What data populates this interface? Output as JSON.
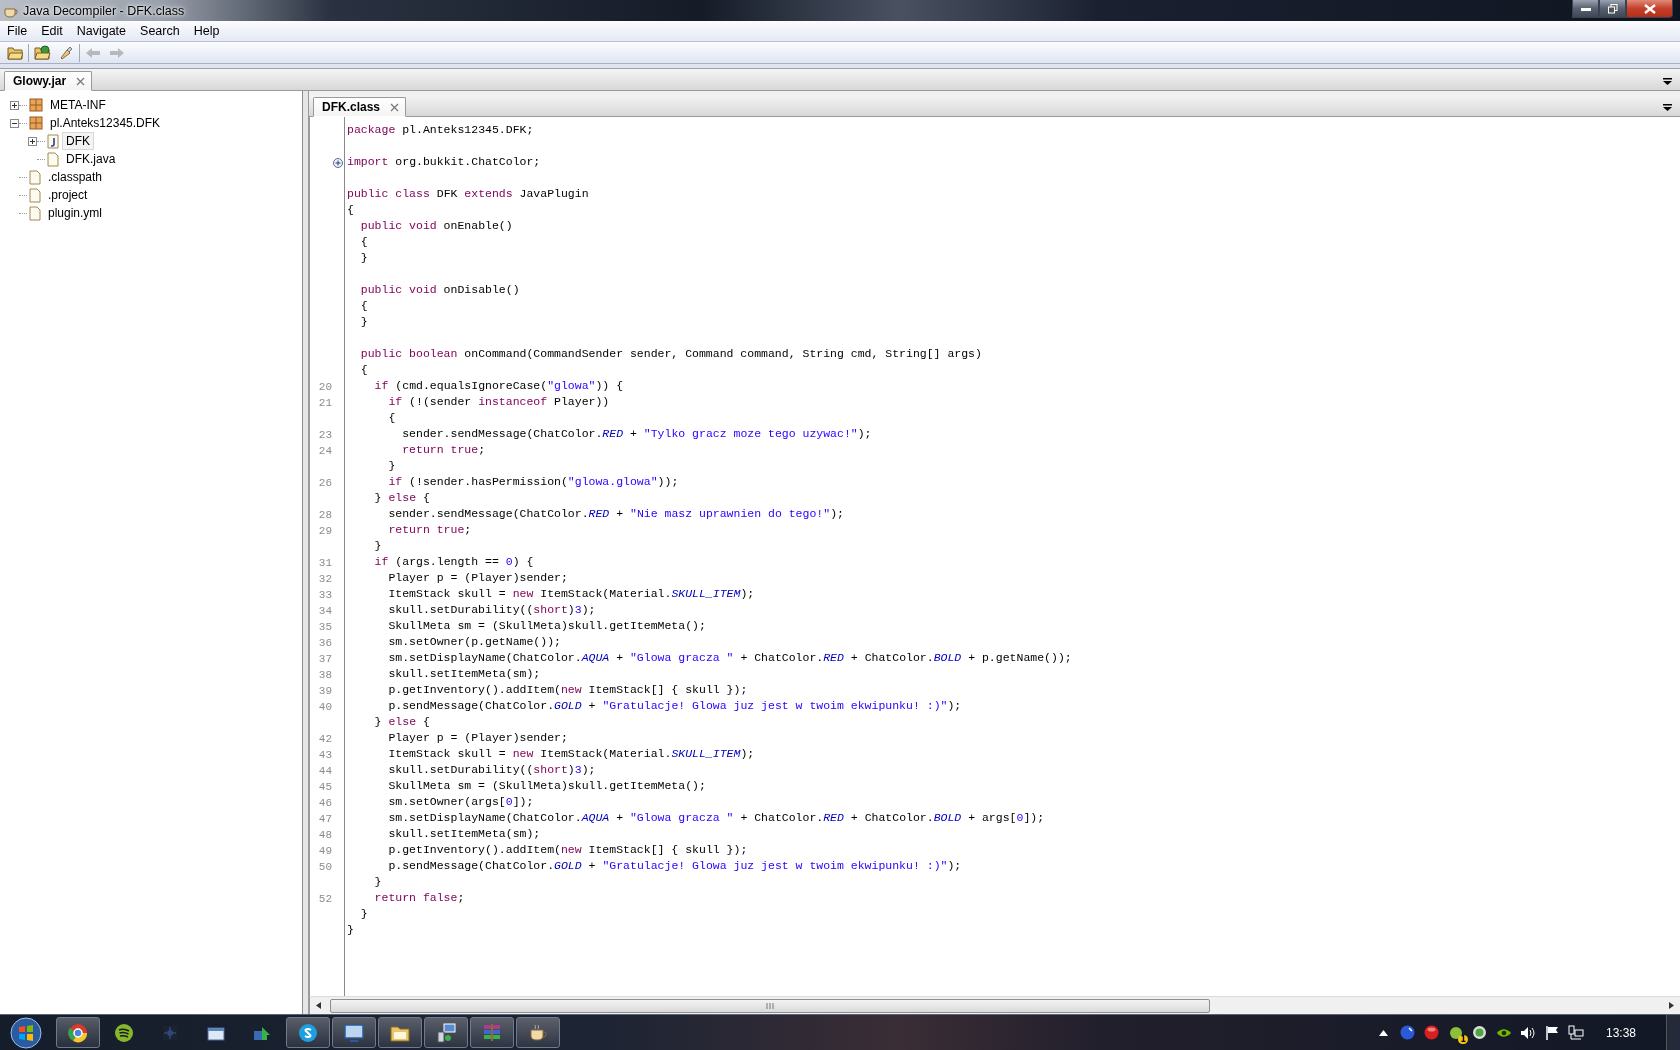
{
  "window": {
    "title": "Java Decompiler - DFK.class"
  },
  "menu": [
    "File",
    "Edit",
    "Navigate",
    "Search",
    "Help"
  ],
  "toolbar": [
    [
      {
        "kind": "open",
        "disabled": false
      }
    ],
    [
      {
        "kind": "open-type",
        "disabled": false
      },
      {
        "kind": "search",
        "disabled": false
      }
    ],
    [
      {
        "kind": "back",
        "disabled": true
      },
      {
        "kind": "forward",
        "disabled": true
      }
    ]
  ],
  "archive_tabs": [
    {
      "label": "Glowy.jar",
      "selected": true
    }
  ],
  "tree": [
    {
      "label": "META-INF",
      "kind": "package",
      "expanded": false,
      "selected": false
    },
    {
      "label": "pl.Anteks12345.DFK",
      "kind": "package",
      "expanded": true,
      "selected": false,
      "children": [
        {
          "label": "DFK",
          "kind": "class",
          "expanded": false,
          "selected": true
        },
        {
          "label": "DFK.java",
          "kind": "file",
          "selected": false
        }
      ]
    },
    {
      "label": ".classpath",
      "kind": "file",
      "selected": false
    },
    {
      "label": ".project",
      "kind": "file",
      "selected": false
    },
    {
      "label": "plugin.yml",
      "kind": "file",
      "selected": false
    }
  ],
  "editor": {
    "tabs": [
      {
        "label": "DFK.class",
        "selected": true
      }
    ],
    "lines": [
      {
        "kind": "code",
        "segments": [
          {
            "kind": "keyword",
            "text": "package"
          },
          {
            "kind": "plain",
            "text": " pl.Anteks12345.DFK;"
          }
        ]
      },
      {
        "kind": "blank"
      },
      {
        "kind": "folded",
        "segments": [
          {
            "kind": "keyword",
            "text": "import"
          },
          {
            "kind": "plain",
            "text": " org.bukkit.ChatColor;"
          }
        ]
      },
      {
        "kind": "blank"
      },
      {
        "kind": "code",
        "segments": [
          {
            "kind": "keyword",
            "text": "public class"
          },
          {
            "kind": "plain",
            "text": " DFK "
          },
          {
            "kind": "keyword",
            "text": "extends"
          },
          {
            "kind": "plain",
            "text": " JavaPlugin"
          }
        ]
      },
      {
        "kind": "code",
        "segments": [
          {
            "kind": "plain",
            "text": "{"
          }
        ]
      },
      {
        "kind": "code",
        "segments": [
          {
            "kind": "keyword",
            "text": "  public void"
          },
          {
            "kind": "plain",
            "text": " onEnable()"
          }
        ]
      },
      {
        "kind": "code",
        "segments": [
          {
            "kind": "plain",
            "text": "  {"
          }
        ]
      },
      {
        "kind": "code",
        "segments": [
          {
            "kind": "plain",
            "text": "  }"
          }
        ]
      },
      {
        "kind": "blank"
      },
      {
        "kind": "code",
        "segments": [
          {
            "kind": "keyword",
            "text": "  public void"
          },
          {
            "kind": "plain",
            "text": " onDisable()"
          }
        ]
      },
      {
        "kind": "code",
        "segments": [
          {
            "kind": "plain",
            "text": "  {"
          }
        ]
      },
      {
        "kind": "code",
        "segments": [
          {
            "kind": "plain",
            "text": "  }"
          }
        ]
      },
      {
        "kind": "blank"
      },
      {
        "kind": "code",
        "segments": [
          {
            "kind": "keyword",
            "text": "  public boolean"
          },
          {
            "kind": "plain",
            "text": " onCommand(CommandSender sender, Command command, String cmd, String[] args)"
          }
        ]
      },
      {
        "kind": "code",
        "segments": [
          {
            "kind": "plain",
            "text": "  {"
          }
        ]
      },
      {
        "kind": "code",
        "number": "20",
        "segments": [
          {
            "kind": "keyword",
            "text": "    if"
          },
          {
            "kind": "plain",
            "text": " (cmd.equalsIgnoreCase("
          },
          {
            "kind": "string",
            "text": "\"glowa\""
          },
          {
            "kind": "plain",
            "text": ")) {"
          }
        ]
      },
      {
        "kind": "code",
        "number": "21",
        "segments": [
          {
            "kind": "keyword",
            "text": "      if"
          },
          {
            "kind": "plain",
            "text": " (!(sender "
          },
          {
            "kind": "keyword",
            "text": "instanceof"
          },
          {
            "kind": "plain",
            "text": " Player))"
          }
        ]
      },
      {
        "kind": "code",
        "segments": [
          {
            "kind": "plain",
            "text": "      {"
          }
        ]
      },
      {
        "kind": "code",
        "number": "23",
        "segments": [
          {
            "kind": "plain",
            "text": "        sender.sendMessage(ChatColor."
          },
          {
            "kind": "field",
            "text": "RED"
          },
          {
            "kind": "plain",
            "text": " + "
          },
          {
            "kind": "string",
            "text": "\"Tylko gracz moze tego uzywac!\""
          },
          {
            "kind": "plain",
            "text": ");"
          }
        ]
      },
      {
        "kind": "code",
        "number": "24",
        "segments": [
          {
            "kind": "keyword",
            "text": "        return true"
          },
          {
            "kind": "plain",
            "text": ";"
          }
        ]
      },
      {
        "kind": "code",
        "segments": [
          {
            "kind": "plain",
            "text": "      }"
          }
        ]
      },
      {
        "kind": "code",
        "number": "26",
        "segments": [
          {
            "kind": "keyword",
            "text": "      if"
          },
          {
            "kind": "plain",
            "text": " (!sender.hasPermission("
          },
          {
            "kind": "string",
            "text": "\"glowa.glowa\""
          },
          {
            "kind": "plain",
            "text": "));"
          }
        ]
      },
      {
        "kind": "code",
        "segments": [
          {
            "kind": "plain",
            "text": "    } "
          },
          {
            "kind": "keyword",
            "text": "else"
          },
          {
            "kind": "plain",
            "text": " {"
          }
        ]
      },
      {
        "kind": "code",
        "number": "28",
        "segments": [
          {
            "kind": "plain",
            "text": "      sender.sendMessage(ChatColor."
          },
          {
            "kind": "field",
            "text": "RED"
          },
          {
            "kind": "plain",
            "text": " + "
          },
          {
            "kind": "string",
            "text": "\"Nie masz uprawnien do tego!\""
          },
          {
            "kind": "plain",
            "text": ");"
          }
        ]
      },
      {
        "kind": "code",
        "number": "29",
        "segments": [
          {
            "kind": "keyword",
            "text": "      return true"
          },
          {
            "kind": "plain",
            "text": ";"
          }
        ]
      },
      {
        "kind": "code",
        "segments": [
          {
            "kind": "plain",
            "text": "    }"
          }
        ]
      },
      {
        "kind": "code",
        "number": "31",
        "segments": [
          {
            "kind": "keyword",
            "text": "    if"
          },
          {
            "kind": "plain",
            "text": " (args.length == "
          },
          {
            "kind": "number",
            "text": "0"
          },
          {
            "kind": "plain",
            "text": ") {"
          }
        ]
      },
      {
        "kind": "code",
        "number": "32",
        "segments": [
          {
            "kind": "plain",
            "text": "      Player p = (Player)sender;"
          }
        ]
      },
      {
        "kind": "code",
        "number": "33",
        "segments": [
          {
            "kind": "plain",
            "text": "      ItemStack skull = "
          },
          {
            "kind": "keyword",
            "text": "new"
          },
          {
            "kind": "plain",
            "text": " ItemStack(Material."
          },
          {
            "kind": "field",
            "text": "SKULL_ITEM"
          },
          {
            "kind": "plain",
            "text": ");"
          }
        ]
      },
      {
        "kind": "code",
        "number": "34",
        "segments": [
          {
            "kind": "plain",
            "text": "      skull.setDurability(("
          },
          {
            "kind": "keyword",
            "text": "short"
          },
          {
            "kind": "plain",
            "text": ")"
          },
          {
            "kind": "number",
            "text": "3"
          },
          {
            "kind": "plain",
            "text": ");"
          }
        ]
      },
      {
        "kind": "code",
        "number": "35",
        "segments": [
          {
            "kind": "plain",
            "text": "      SkullMeta sm = (SkullMeta)skull.getItemMeta();"
          }
        ]
      },
      {
        "kind": "code",
        "number": "36",
        "segments": [
          {
            "kind": "plain",
            "text": "      sm.setOwner(p.getName());"
          }
        ]
      },
      {
        "kind": "code",
        "number": "37",
        "segments": [
          {
            "kind": "plain",
            "text": "      sm.setDisplayName(ChatColor."
          },
          {
            "kind": "field",
            "text": "AQUA"
          },
          {
            "kind": "plain",
            "text": " + "
          },
          {
            "kind": "string",
            "text": "\"Glowa gracza \""
          },
          {
            "kind": "plain",
            "text": " + ChatColor."
          },
          {
            "kind": "field",
            "text": "RED"
          },
          {
            "kind": "plain",
            "text": " + ChatColor."
          },
          {
            "kind": "field",
            "text": "BOLD"
          },
          {
            "kind": "plain",
            "text": " + p.getName());"
          }
        ]
      },
      {
        "kind": "code",
        "number": "38",
        "segments": [
          {
            "kind": "plain",
            "text": "      skull.setItemMeta(sm);"
          }
        ]
      },
      {
        "kind": "code",
        "number": "39",
        "segments": [
          {
            "kind": "plain",
            "text": "      p.getInventory().addItem("
          },
          {
            "kind": "keyword",
            "text": "new"
          },
          {
            "kind": "plain",
            "text": " ItemStack[] { skull });"
          }
        ]
      },
      {
        "kind": "code",
        "number": "40",
        "segments": [
          {
            "kind": "plain",
            "text": "      p.sendMessage(ChatColor."
          },
          {
            "kind": "field",
            "text": "GOLD"
          },
          {
            "kind": "plain",
            "text": " + "
          },
          {
            "kind": "string",
            "text": "\"Gratulacje! Glowa juz jest w twoim ekwipunku! :)\""
          },
          {
            "kind": "plain",
            "text": ");"
          }
        ]
      },
      {
        "kind": "code",
        "segments": [
          {
            "kind": "plain",
            "text": "    } "
          },
          {
            "kind": "keyword",
            "text": "else"
          },
          {
            "kind": "plain",
            "text": " {"
          }
        ]
      },
      {
        "kind": "code",
        "number": "42",
        "segments": [
          {
            "kind": "plain",
            "text": "      Player p = (Player)sender;"
          }
        ]
      },
      {
        "kind": "code",
        "number": "43",
        "segments": [
          {
            "kind": "plain",
            "text": "      ItemStack skull = "
          },
          {
            "kind": "keyword",
            "text": "new"
          },
          {
            "kind": "plain",
            "text": " ItemStack(Material."
          },
          {
            "kind": "field",
            "text": "SKULL_ITEM"
          },
          {
            "kind": "plain",
            "text": ");"
          }
        ]
      },
      {
        "kind": "code",
        "number": "44",
        "segments": [
          {
            "kind": "plain",
            "text": "      skull.setDurability(("
          },
          {
            "kind": "keyword",
            "text": "short"
          },
          {
            "kind": "plain",
            "text": ")"
          },
          {
            "kind": "number",
            "text": "3"
          },
          {
            "kind": "plain",
            "text": ");"
          }
        ]
      },
      {
        "kind": "code",
        "number": "45",
        "segments": [
          {
            "kind": "plain",
            "text": "      SkullMeta sm = (SkullMeta)skull.getItemMeta();"
          }
        ]
      },
      {
        "kind": "code",
        "number": "46",
        "segments": [
          {
            "kind": "plain",
            "text": "      sm.setOwner(args["
          },
          {
            "kind": "number",
            "text": "0"
          },
          {
            "kind": "plain",
            "text": "]);"
          }
        ]
      },
      {
        "kind": "code",
        "number": "47",
        "segments": [
          {
            "kind": "plain",
            "text": "      sm.setDisplayName(ChatColor."
          },
          {
            "kind": "field",
            "text": "AQUA"
          },
          {
            "kind": "plain",
            "text": " + "
          },
          {
            "kind": "string",
            "text": "\"Glowa gracza \""
          },
          {
            "kind": "plain",
            "text": " + ChatColor."
          },
          {
            "kind": "field",
            "text": "RED"
          },
          {
            "kind": "plain",
            "text": " + ChatColor."
          },
          {
            "kind": "field",
            "text": "BOLD"
          },
          {
            "kind": "plain",
            "text": " + args["
          },
          {
            "kind": "number",
            "text": "0"
          },
          {
            "kind": "plain",
            "text": "]);"
          }
        ]
      },
      {
        "kind": "code",
        "number": "48",
        "segments": [
          {
            "kind": "plain",
            "text": "      skull.setItemMeta(sm);"
          }
        ]
      },
      {
        "kind": "code",
        "number": "49",
        "segments": [
          {
            "kind": "plain",
            "text": "      p.getInventory().addItem("
          },
          {
            "kind": "keyword",
            "text": "new"
          },
          {
            "kind": "plain",
            "text": " ItemStack[] { skull });"
          }
        ]
      },
      {
        "kind": "code",
        "number": "50",
        "segments": [
          {
            "kind": "plain",
            "text": "      p.sendMessage(ChatColor."
          },
          {
            "kind": "field",
            "text": "GOLD"
          },
          {
            "kind": "plain",
            "text": " + "
          },
          {
            "kind": "string",
            "text": "\"Gratulacje! Glowa juz jest w twoim ekwipunku! :)\""
          },
          {
            "kind": "plain",
            "text": ");"
          }
        ]
      },
      {
        "kind": "code",
        "segments": [
          {
            "kind": "plain",
            "text": "    }"
          }
        ]
      },
      {
        "kind": "code",
        "number": "52",
        "segments": [
          {
            "kind": "keyword",
            "text": "    return false"
          },
          {
            "kind": "plain",
            "text": ";"
          }
        ]
      },
      {
        "kind": "code",
        "segments": [
          {
            "kind": "plain",
            "text": "  }"
          }
        ]
      },
      {
        "kind": "code",
        "segments": [
          {
            "kind": "plain",
            "text": "}"
          }
        ]
      }
    ]
  },
  "taskbar": {
    "apps": [
      {
        "kind": "browser",
        "running": true
      },
      {
        "kind": "music",
        "running": false
      },
      {
        "kind": "game",
        "running": false
      },
      {
        "kind": "window",
        "running": false
      },
      {
        "kind": "share",
        "running": false
      },
      {
        "kind": "chat",
        "running": true
      },
      {
        "kind": "screen",
        "running": true
      },
      {
        "kind": "folder",
        "running": true
      },
      {
        "kind": "network",
        "running": true
      },
      {
        "kind": "archive",
        "running": true
      },
      {
        "kind": "coffee",
        "running": true
      }
    ],
    "tray": [
      {
        "kind": "show-hidden"
      },
      {
        "kind": "sphere"
      },
      {
        "kind": "record"
      },
      {
        "kind": "update",
        "badge": "1"
      },
      {
        "kind": "ring"
      },
      {
        "kind": "gpu"
      },
      {
        "kind": "volume"
      },
      {
        "kind": "flag"
      },
      {
        "kind": "network"
      }
    ],
    "clock": "13:38"
  }
}
